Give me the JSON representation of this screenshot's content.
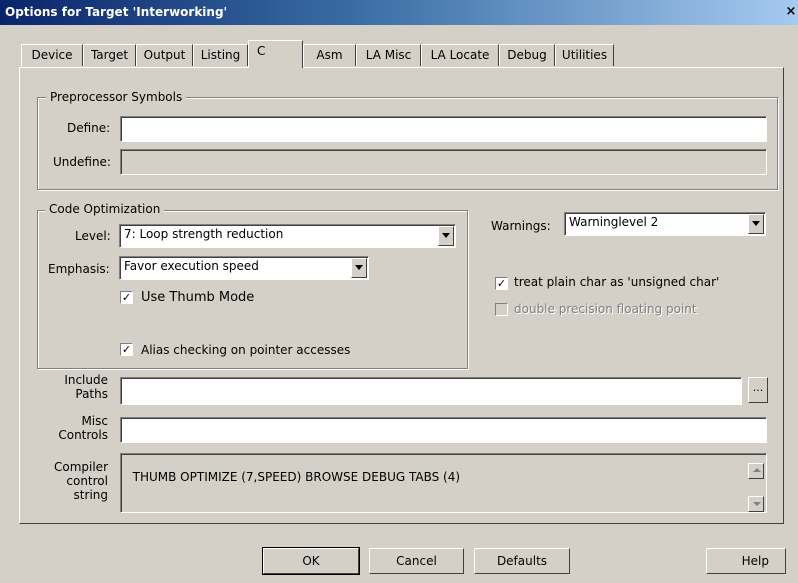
{
  "window": {
    "title": "Options for Target 'Interworking'",
    "close_glyph": "×"
  },
  "tabs": [
    {
      "label": "Device"
    },
    {
      "label": "Target"
    },
    {
      "label": "Output"
    },
    {
      "label": "Listing"
    },
    {
      "label": "C",
      "active": true
    },
    {
      "label": "Asm"
    },
    {
      "label": "LA Misc"
    },
    {
      "label": "LA Locate"
    },
    {
      "label": "Debug"
    },
    {
      "label": "Utilities"
    }
  ],
  "preprocessor": {
    "legend": "Preprocessor Symbols",
    "define_label": "Define:",
    "define_value": "",
    "undefine_label": "Undefine:",
    "undefine_value": ""
  },
  "optimization": {
    "legend": "Code Optimization",
    "level_label": "Level:",
    "level_value": "7: Loop strength reduction",
    "emphasis_label": "Emphasis:",
    "emphasis_value": "Favor execution speed",
    "thumb_label": "Use Thumb Mode",
    "thumb_checked": "✓",
    "alias_label": "Alias checking on pointer accesses",
    "alias_checked": "✓"
  },
  "warnings": {
    "label": "Warnings:",
    "value": "Warninglevel 2"
  },
  "options": {
    "unsigned_char_label": "treat plain char as 'unsigned char'",
    "unsigned_char_checked": "✓",
    "double_precision_label": "double precision floating point"
  },
  "include_paths": {
    "label_line1": "Include",
    "label_line2": "Paths",
    "value": "",
    "browse_label": "..."
  },
  "misc_controls": {
    "label_line1": "Misc",
    "label_line2": "Controls",
    "value": ""
  },
  "compiler_control": {
    "label_line1": "Compiler",
    "label_line2": "control",
    "label_line3": "string",
    "value": "THUMB OPTIMIZE (7,SPEED) BROWSE DEBUG TABS (4)"
  },
  "buttons": {
    "ok": "OK",
    "cancel": "Cancel",
    "defaults": "Defaults",
    "help": "Help"
  }
}
